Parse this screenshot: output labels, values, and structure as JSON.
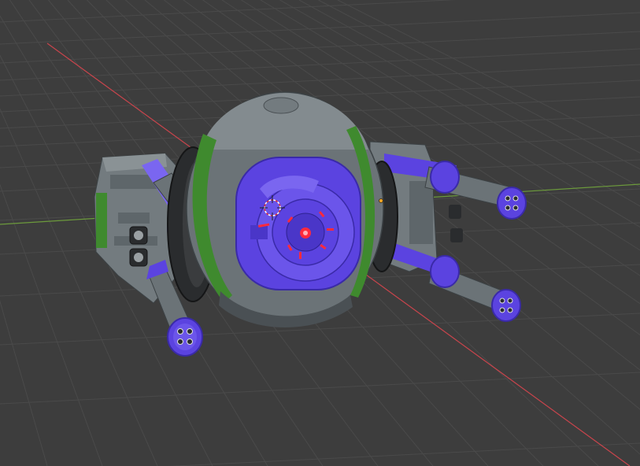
{
  "viewport": {
    "background": "#3d3d3d",
    "grid_color": "#4a4a4a",
    "x_axis_color": "#c8444c",
    "y_axis_color": "#6c9a3c"
  },
  "model": {
    "palette": {
      "hull_gray": "#6b7377",
      "hull_dark": "#4a5054",
      "hull_light": "#838b8f",
      "accent_green": "#3f8a2e",
      "accent_purple": "#5b43e0",
      "accent_purple_light": "#7a66f0",
      "accent_purple_dark": "#3a2aa8",
      "rubber_black": "#2a2c2e",
      "laser_red": "#ff2a3d"
    },
    "gizmos": {
      "cursor_3d": "3d-cursor-icon",
      "origin_point": "origin-icon"
    }
  }
}
